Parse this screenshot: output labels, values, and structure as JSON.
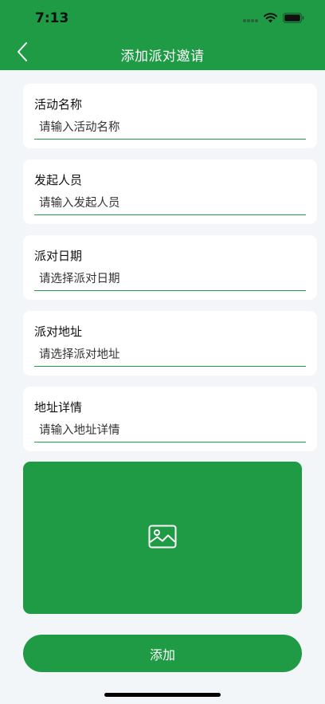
{
  "status_bar": {
    "time": "7:13"
  },
  "nav": {
    "title": "添加派对邀请",
    "back_icon": "chevron-left-icon"
  },
  "form": {
    "fields": [
      {
        "label": "活动名称",
        "placeholder": "请输入活动名称"
      },
      {
        "label": "发起人员",
        "placeholder": "请输入发起人员"
      },
      {
        "label": "派对日期",
        "placeholder": "请选择派对日期"
      },
      {
        "label": "派对地址",
        "placeholder": "请选择派对地址"
      },
      {
        "label": "地址详情",
        "placeholder": "请输入地址详情"
      }
    ],
    "image_upload_icon": "image-icon",
    "submit_label": "添加"
  },
  "colors": {
    "primary": "#1f9a45",
    "background": "#f3f6f9",
    "card": "#ffffff"
  }
}
